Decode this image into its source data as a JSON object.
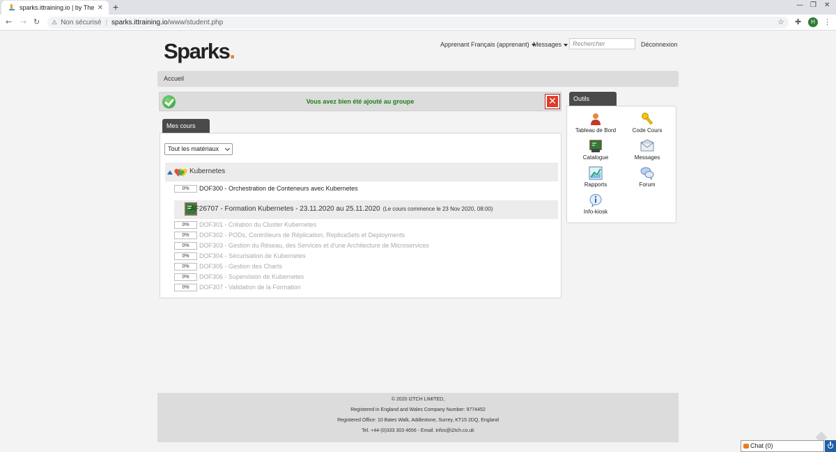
{
  "browser": {
    "tab_title": "sparks.ittraining.io | by The IT",
    "security_label": "Non sécurisé",
    "url_host": "sparks.ittraining.io",
    "url_path": "/www/student.php",
    "profile_initial": "H"
  },
  "header": {
    "logo_text": "Sparks",
    "logo_dot": ".",
    "user_menu": "Apprenant Français (apprenant)",
    "messages_menu": "Messages",
    "search_placeholder": "Rechercher",
    "logout": "Déconnexion"
  },
  "breadcrumb": "Accueil",
  "alert": {
    "message": "Vous avez bien été ajouté au groupe",
    "close_glyph": "✕"
  },
  "courses": {
    "tab_label": "Mes cours",
    "filter_value": "Tout les matériaux",
    "category": {
      "title": "Kubernetes",
      "items": [
        {
          "progress": "0%",
          "label": "DOF300 - Orchestration de Conteneurs avec Kubernetes"
        }
      ]
    },
    "session": {
      "title": "AF26707 - Formation Kubernetes - 23.11.2020 au 25.11.2020",
      "note": "(Le cours commence le 23 Nov 2020, 08:00)",
      "items": [
        {
          "progress": "0%",
          "label": "DOF301 - Création du Cluster Kubernetes"
        },
        {
          "progress": "0%",
          "label": "DOF302 - PODs, Contrôleurs de Réplication, ReplicaSets et Deployments"
        },
        {
          "progress": "0%",
          "label": "DOF303 - Gestion du Réseau, des Services et d'une Architecture de Microservices"
        },
        {
          "progress": "0%",
          "label": "DOF304 - Sécurisation de Kubernetes"
        },
        {
          "progress": "0%",
          "label": "DOF305 - Gestion des Charts"
        },
        {
          "progress": "0%",
          "label": "DOF306 - Supervision de Kubernetes"
        },
        {
          "progress": "0%",
          "label": "DOF307 - Validation de la Formation"
        }
      ]
    }
  },
  "tools": {
    "tab_label": "Outils",
    "items": [
      {
        "label": "Tableau de Bord",
        "icon": "user-icon"
      },
      {
        "label": "Code Cours",
        "icon": "key-icon"
      },
      {
        "label": "Catalogue",
        "icon": "catalog-icon"
      },
      {
        "label": "Messages",
        "icon": "envelope-icon"
      },
      {
        "label": "Rapports",
        "icon": "chart-icon"
      },
      {
        "label": "Forum",
        "icon": "chat-bubbles-icon"
      },
      {
        "label": "Info-kiosk",
        "icon": "info-icon"
      }
    ]
  },
  "footer": {
    "line1": "© 2020 I2TCH LIMITED,",
    "line2": "Registered in England and Wales Company Number: 9774452",
    "line3": "Registered Office: 10 Bates Walk, Addlestone, Surrey, KT15 2DQ, England",
    "line4": "Tel. +44-(0)333 303 4656 - Email. infos@i2tch.co.uk"
  },
  "chat": {
    "label": "Chat (0)"
  }
}
